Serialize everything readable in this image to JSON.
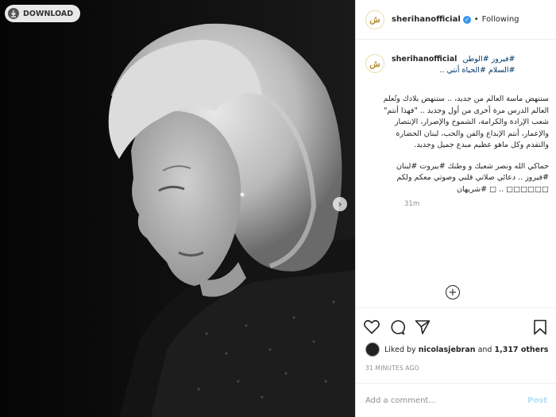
{
  "photo": {
    "download_label": "DOWNLOAD",
    "download_icon": "download-icon",
    "next_icon": "chevron-right-icon"
  },
  "header": {
    "username": "sherihanofficial",
    "verified_icon": "verified-badge-icon",
    "separator": "•",
    "follow_status": "Following"
  },
  "caption": {
    "username": "sherihanofficial",
    "hashtags_line1": "#فيروز #الوطن",
    "hashtags_line2": "#السلام #الحياة أنتي ..",
    "paragraph1": "ستنهض ماسة العالم من جديد، .. ستنهض بلادك وتُعلم العالم الدرس مرة أخرى من أول وجديد .. \"فهذا أنتم\" شعب الإرادة والكرامة، الشموخ والإصرار، الإنتصار والإعمار، أنتم الإبداع والفن والحب، لبنان الحضارة والتقدم وكل ماهو عظيم مبدع جميل وجديد.",
    "paragraph2": "حماكي الله ونصر شعبك و وطنك #بيروت #لبنان #فيروز .. دعائي صلاتي قلبي وصوتي معكم ولكم □□□□□□ .. □ #شريهان",
    "time": "31m"
  },
  "actions": {
    "like_icon": "heart-icon",
    "comment_icon": "comment-icon",
    "share_icon": "share-icon",
    "save_icon": "bookmark-icon",
    "load_more_icon": "plus-circle-icon"
  },
  "likes": {
    "prefix": "Liked by",
    "user": "nicolasjebran",
    "middle": "and",
    "count": "1,317 others"
  },
  "timestamp": "31 MINUTES AGO",
  "comment": {
    "placeholder": "Add a comment...",
    "post_label": "Post"
  },
  "colors": {
    "link": "#00376b",
    "verified": "#3897f0",
    "post_disabled": "#b2dffc",
    "muted": "#8e8e8e"
  }
}
